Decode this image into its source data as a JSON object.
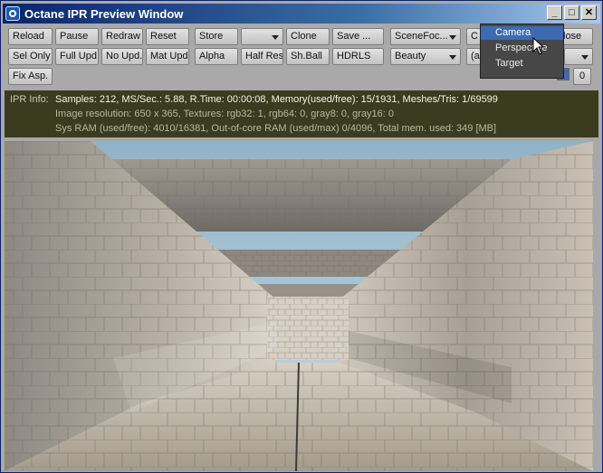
{
  "window": {
    "title": "Octane IPR Preview Window"
  },
  "titlebar_buttons": {
    "minimize": "_",
    "maximize": "□",
    "close": "✕"
  },
  "toolbar": {
    "reload": "Reload",
    "pause": "Pause",
    "redraw": "Redraw",
    "reset": "Reset",
    "store": "Store",
    "store_slot": "",
    "clone": "Clone",
    "save": "Save ...",
    "scene_focus": "SceneFoc...",
    "cam_partial": "C",
    "close_partial": "lose",
    "sel_only": "Sel Only",
    "full_upd": "Full Upd.",
    "no_upd": "No Upd.",
    "mat_upd": "Mat Upd",
    "alpha": "Alpha",
    "half_res": "Half Res",
    "sh_ball": "Sh.Ball",
    "hdrls": "HDRLS",
    "beauty": "Beauty",
    "a_partial": "(a",
    "counter_value": "0",
    "fix_asp": "Fix Asp."
  },
  "camera_menu": {
    "items": [
      "Camera",
      "Perspective",
      "Target"
    ],
    "selected": "Camera"
  },
  "ipr_info": {
    "label": "IPR Info:",
    "line1": "Samples: 212, MS/Sec.: 5.88, R.Time: 00:00:08, Memory(used/free): 15/1931, Meshes/Tris: 1/69599",
    "line2": "Image resolution: 650 x 365, Textures:  rgb32: 1, rgb64: 0, gray8: 0, gray16: 0",
    "line3": "Sys RAM (used/free): 4010/16381, Out-of-core RAM (used/max) 0/4096, Total mem. used: 349  [MB]"
  },
  "colors": {
    "title_start": "#0a246a",
    "title_end": "#a6caf0",
    "info_bg": "#3b3b1f",
    "menu_selected": "#3d6bb3"
  },
  "icons": {
    "app": "octane-logo-icon",
    "cursor": "mouse-pointer-icon"
  }
}
